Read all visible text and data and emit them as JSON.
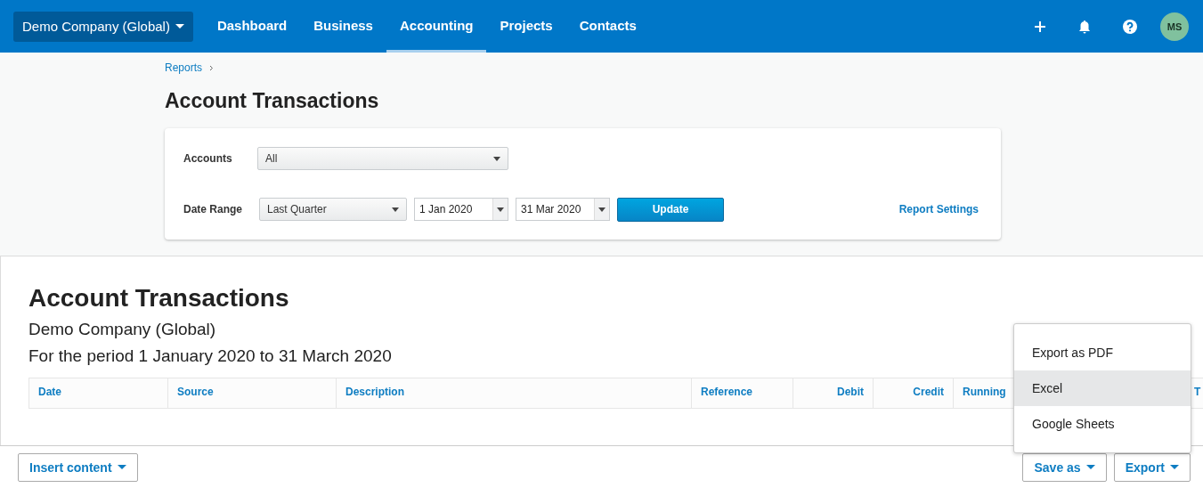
{
  "top_nav": {
    "org_switcher": "Demo Company (Global)",
    "items": [
      {
        "label": "Dashboard",
        "selected": false
      },
      {
        "label": "Business",
        "selected": false
      },
      {
        "label": "Accounting",
        "selected": true
      },
      {
        "label": "Projects",
        "selected": false
      },
      {
        "label": "Contacts",
        "selected": false
      }
    ],
    "avatar": "MS"
  },
  "breadcrumb": "Reports",
  "page_title": "Account Transactions",
  "filters": {
    "accounts_label": "Accounts",
    "accounts_value": "All",
    "date_range_label": "Date Range",
    "period": "Last Quarter",
    "from": "1 Jan 2020",
    "to": "31 Mar 2020",
    "update_button": "Update",
    "settings_link": "Report Settings"
  },
  "report": {
    "title": "Account Transactions",
    "company": "Demo Company (Global)",
    "period": "For the period 1 January 2020 to 31 March 2020",
    "columns": [
      {
        "label": "Date",
        "kind": "text"
      },
      {
        "label": "Source",
        "kind": "text"
      },
      {
        "label": "Description",
        "kind": "text"
      },
      {
        "label": "Reference",
        "kind": "text"
      },
      {
        "label": "Debit",
        "kind": "amount"
      },
      {
        "label": "Credit",
        "kind": "amount"
      },
      {
        "label": "Running",
        "kind": "text"
      },
      {
        "label": "T",
        "kind": "text"
      }
    ]
  },
  "export_menu": [
    {
      "label": "Export as PDF",
      "selected": false
    },
    {
      "label": "Excel",
      "selected": true
    },
    {
      "label": "Google Sheets",
      "selected": false
    }
  ],
  "footer": {
    "insert_button": "Insert content",
    "save_button": "Save as",
    "export_button": "Export"
  }
}
